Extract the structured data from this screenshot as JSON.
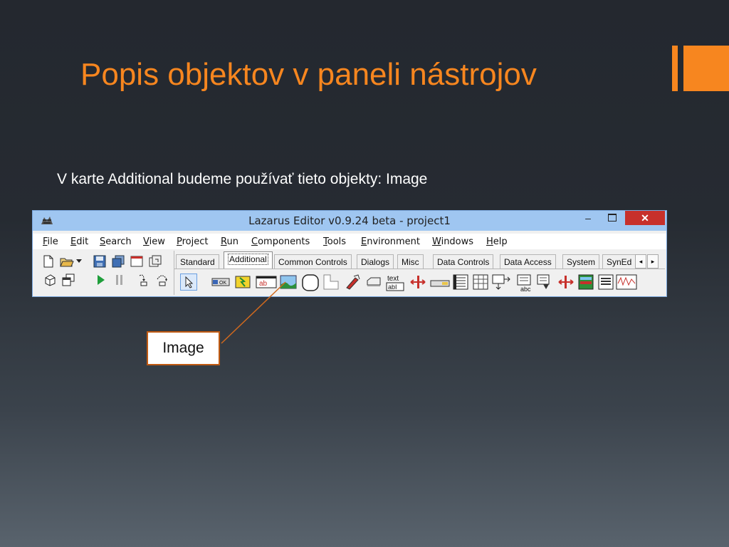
{
  "slide": {
    "title": "Popis objektov v paneli nástrojov",
    "body": "V karte Additional budeme používať tieto objekty: Image",
    "callout_label": "Image"
  },
  "window": {
    "title": "Lazarus Editor v0.9.24 beta - project1",
    "close_glyph": "✕",
    "minimize_glyph": "–"
  },
  "menu": [
    "File",
    "Edit",
    "Search",
    "View",
    "Project",
    "Run",
    "Components",
    "Tools",
    "Environment",
    "Windows",
    "Help"
  ],
  "tabs": [
    "Standard",
    "Additional",
    "Common Controls",
    "Dialogs",
    "Misc",
    "Data Controls",
    "Data Access",
    "System",
    "SynEd"
  ],
  "active_tab": "Additional",
  "palette_text": {
    "ok": "OK",
    "ab": "ab",
    "text_top": "text",
    "text_bottom": "abI",
    "abc": "abc"
  },
  "colors": {
    "accent": "#f7861f",
    "titlebar": "#9fc6f1",
    "close_button": "#c7302b",
    "callout_border": "#c05a12"
  },
  "icons": [
    "new-file-icon",
    "open-folder-icon",
    "dropdown-icon",
    "save-icon",
    "save-all-icon",
    "window-icon",
    "toggle-form-icon",
    "view-units-icon",
    "view-forms-icon",
    "run-icon",
    "pause-icon",
    "step-into-icon",
    "step-over-icon",
    "pointer-icon",
    "bitbtn-icon",
    "speedbutton-icon",
    "maskedit-icon",
    "image-icon",
    "shape-icon",
    "bevel-icon",
    "scrollbox-icon",
    "checkgroup-icon",
    "labeledit-icon",
    "splitter-icon",
    "staticText-icon",
    "trayicon-icon",
    "stringgrid-icon",
    "drawgrid-icon",
    "pairsplitter-icon",
    "colorbox-icon",
    "colorlistbox-icon",
    "chart-icon"
  ]
}
